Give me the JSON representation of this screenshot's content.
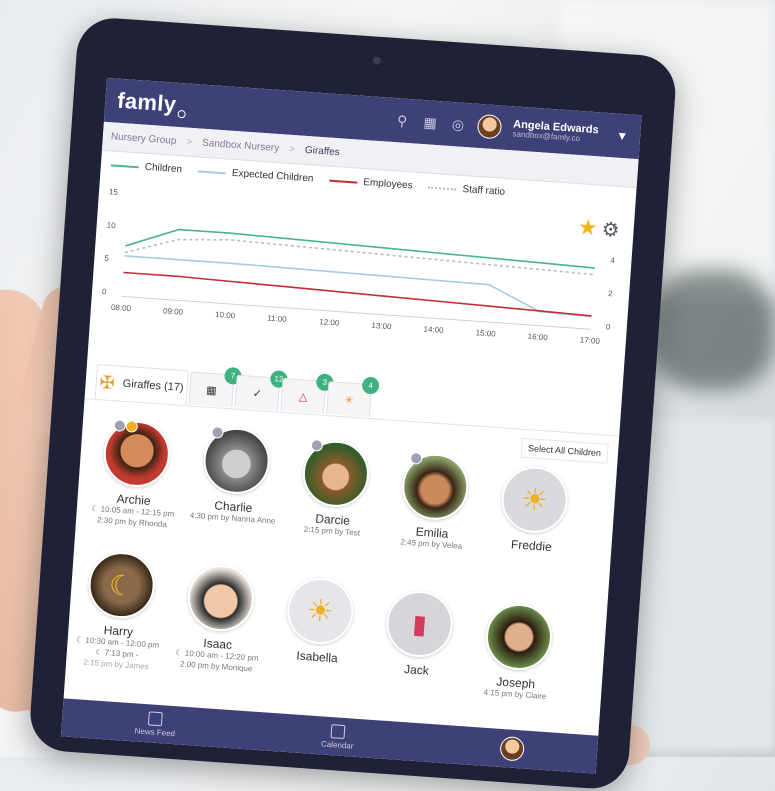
{
  "app": {
    "logo_text": "famly"
  },
  "user": {
    "name": "Angela Edwards",
    "email": "sandbox@famly.co"
  },
  "breadcrumb": [
    "Nursery Group",
    "Sandbox Nursery",
    "Giraffes"
  ],
  "legend": [
    "Children",
    "Expected Children",
    "Employees",
    "Staff ratio"
  ],
  "colors": {
    "children": "#4bb58a",
    "expected": "#a9cbe2",
    "employees": "#c62d36",
    "staff_ratio": "#b9b9c0",
    "brand": "#3e4178",
    "badge": "#3fb27f"
  },
  "chart_data": {
    "type": "line",
    "x": [
      "08:00",
      "09:00",
      "10:00",
      "11:00",
      "12:00",
      "13:00",
      "14:00",
      "15:00",
      "16:00",
      "17:00"
    ],
    "y_left_ticks": [
      "15",
      "10",
      "5",
      "0"
    ],
    "y_right_ticks": [
      "6",
      "4",
      "2",
      "0"
    ],
    "series": [
      {
        "name": "Children",
        "values": [
          7,
          10,
          10,
          9.8,
          9.6,
          9.4,
          9.2,
          9,
          8.8,
          8.6
        ]
      },
      {
        "name": "Expected Children",
        "values": [
          5.5,
          5.5,
          5.5,
          5.4,
          5.3,
          5.2,
          5.1,
          5,
          1.5,
          1.3
        ]
      },
      {
        "name": "Employees",
        "values": [
          3,
          3,
          2.8,
          2.6,
          2.4,
          2.2,
          2,
          1.8,
          1.6,
          1.4
        ]
      },
      {
        "name": "Staff ratio",
        "values": [
          6,
          8.5,
          9,
          8.8,
          8.6,
          8.4,
          8.2,
          8,
          7.8,
          7.6
        ]
      }
    ]
  },
  "tabs": {
    "group_label": "Giraffes (17)",
    "badges": [
      "7",
      "12",
      "3",
      "4"
    ]
  },
  "select_all_label": "Select All Children",
  "children": [
    {
      "name": "Archie",
      "meta": [
        "☾ 10:05 am - 12:15 pm",
        "2:30 pm by Rhonda"
      ]
    },
    {
      "name": "Charlie",
      "meta": [
        "4:30 pm by Nanna Anne"
      ]
    },
    {
      "name": "Darcie",
      "meta": [
        "2:15 pm by Test"
      ]
    },
    {
      "name": "Emilia",
      "meta": [
        "2:45 pm by Velea"
      ]
    },
    {
      "name": "Freddie",
      "meta": []
    },
    {
      "name": "Harry",
      "meta": [
        "☾ 10:30 am - 12:00 pm",
        "☾ 7:13 pm -",
        "2:15 pm by James"
      ]
    },
    {
      "name": "Isaac",
      "meta": [
        "☾ 10:00 am - 12:20 pm",
        "2:00 pm by Monique"
      ]
    },
    {
      "name": "Isabella",
      "meta": []
    },
    {
      "name": "Jack",
      "meta": []
    },
    {
      "name": "Joseph",
      "meta": [
        "4:15 pm by Claire"
      ]
    }
  ],
  "bottom_nav": [
    "News Feed",
    "Calendar"
  ]
}
